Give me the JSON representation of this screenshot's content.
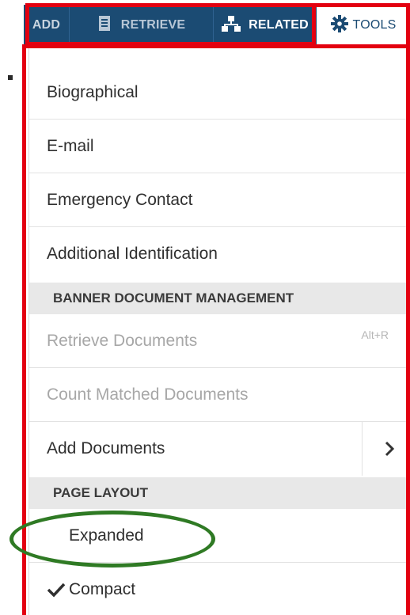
{
  "toolbar": {
    "add_label": "ADD",
    "retrieve_label": "RETRIEVE",
    "related_label": "RELATED",
    "tools_label": "TOOLS"
  },
  "menu": {
    "items": [
      {
        "label": "Biographical"
      },
      {
        "label": "E-mail"
      },
      {
        "label": "Emergency Contact"
      },
      {
        "label": "Additional Identification"
      }
    ],
    "section_banner": "BANNER DOCUMENT MANAGEMENT",
    "banner_items": {
      "retrieve": {
        "label": "Retrieve Documents",
        "shortcut": "Alt+R"
      },
      "count": {
        "label": "Count Matched Documents"
      },
      "add": {
        "label": "Add Documents"
      }
    },
    "section_layout": "PAGE LAYOUT",
    "layout_items": {
      "expanded": {
        "label": "Expanded"
      },
      "compact": {
        "label": "Compact",
        "checked": true
      }
    }
  },
  "colors": {
    "toolbar_bg": "#1b4b73",
    "highlight_red": "#e30010",
    "annotation_green": "#2f7a24",
    "section_bg": "#e8e8e8"
  },
  "icons": {
    "retrieve": "document-icon",
    "related": "sitemap-icon",
    "tools": "gear-icon",
    "submenu": "chevron-right-icon",
    "checked": "checkmark-icon"
  }
}
